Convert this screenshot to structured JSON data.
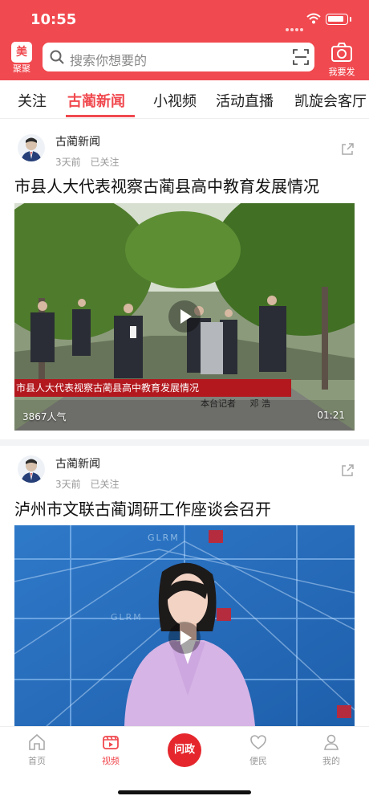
{
  "status_bar": {
    "time": "10:55"
  },
  "header": {
    "logo_text": "聚聚",
    "logo_badge": "美",
    "search_placeholder": "搜索你想要的",
    "post_label": "我要发"
  },
  "tabs": [
    {
      "label": "关注"
    },
    {
      "label": "古蔺新闻",
      "active": true
    },
    {
      "label": "小视频"
    },
    {
      "label": "活动直播"
    },
    {
      "label": "凯旋会客厅"
    }
  ],
  "feed": [
    {
      "source": "古蔺新闻",
      "time_ago": "3天前",
      "follow_status": "已关注",
      "title": "市县人大代表视察古蔺县高中教育发展情况",
      "views": "3867人气",
      "duration": "01:21",
      "video_caption": "市县人大代表视察古蔺县高中教育发展情况",
      "reporter_label": "本台记者",
      "reporter_name": "邓 浩"
    },
    {
      "source": "古蔺新闻",
      "time_ago": "3天前",
      "follow_status": "已关注",
      "title": "泸州市文联古蔺调研工作座谈会召开",
      "watermark": "GLRM"
    }
  ],
  "bottom_nav": [
    {
      "label": "首页",
      "icon": "home-icon"
    },
    {
      "label": "视频",
      "icon": "video-icon",
      "active": true
    },
    {
      "label": "问政",
      "icon": "wenzheng-icon"
    },
    {
      "label": "便民",
      "icon": "heart-icon"
    },
    {
      "label": "我的",
      "icon": "user-icon"
    }
  ],
  "colors": {
    "accent": "#f0494f",
    "active_tab": "#f0494f"
  }
}
